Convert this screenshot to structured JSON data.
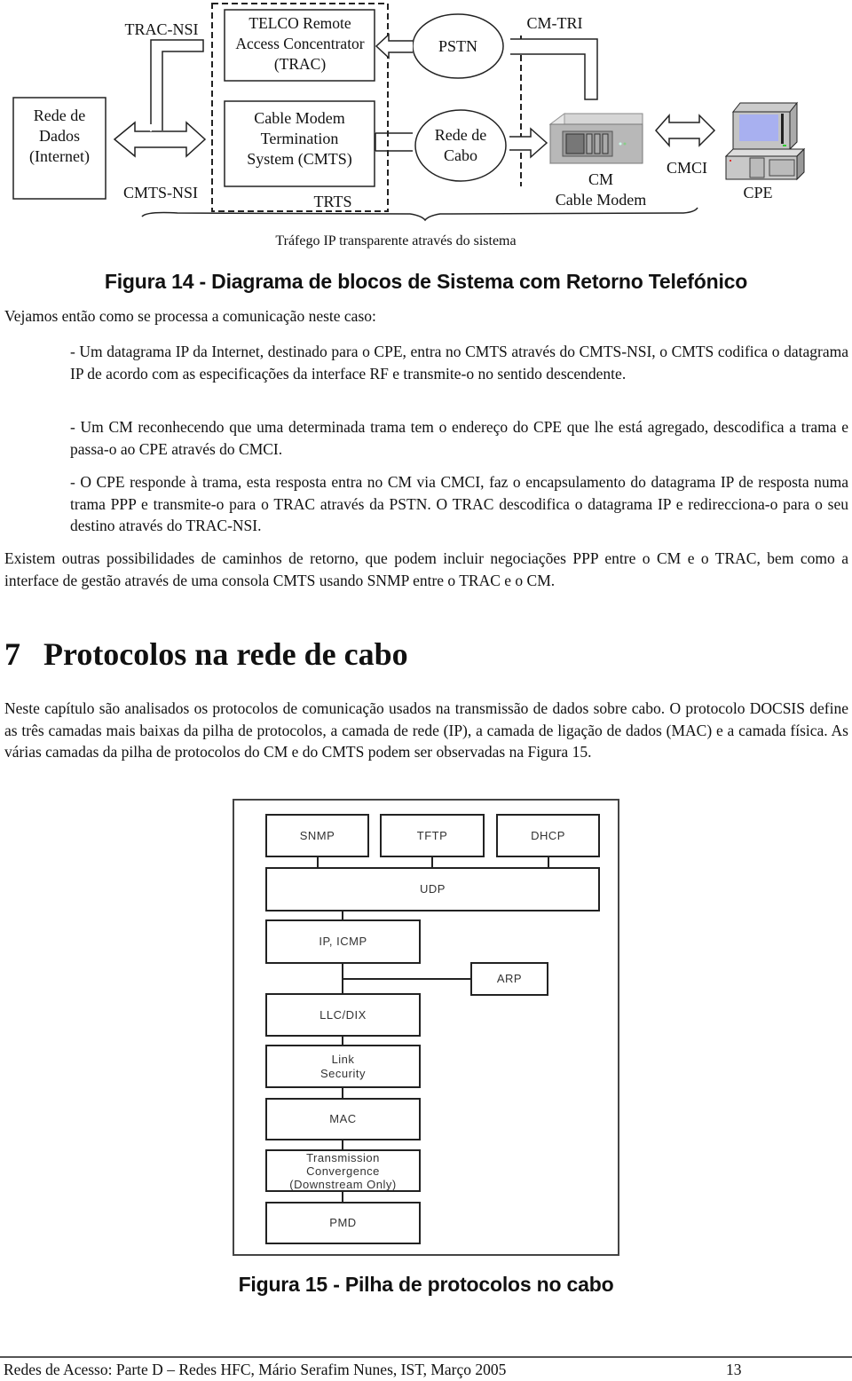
{
  "figure14": {
    "labels": {
      "trac_nsi": "TRAC-NSI",
      "cmts_nsi": "CMTS-NSI",
      "trts": "TRTS",
      "cm_tri": "CM-TRI",
      "cmci": "CMCI",
      "cpe": "CPE"
    },
    "blocks": {
      "rede_dados": "Rede de\nDados\n(Internet)",
      "trac": "TELCO Remote\nAccess Concentrator\n(TRAC)",
      "cmts": "Cable Modem\nTermination\nSystem (CMTS)",
      "pstn": "PSTN",
      "rede_cabo": "Rede de\nCabo",
      "cm": "CM\nCable Modem"
    },
    "brace_label": "Tráfego IP transparente através do sistema",
    "caption": "Figura 14 - Diagrama de blocos de Sistema com Retorno Telefónico"
  },
  "body": {
    "intro": "Vejamos então como se processa a comunicação neste caso:",
    "steps": [
      "- Um datagrama IP da Internet, destinado para o CPE, entra no CMTS através do CMTS-NSI, o CMTS codifica o datagrama IP de acordo com as especificações da interface RF e transmite-o no sentido descendente.",
      "- Um CM reconhecendo que uma determinada trama tem o endereço do CPE que lhe está agregado, descodifica a trama e passa-o ao CPE através do CMCI.",
      "- O CPE responde à trama, esta resposta entra no CM via CMCI, faz o encapsulamento do datagrama IP de resposta numa trama PPP e transmite-o para o TRAC através da PSTN. O TRAC descodifica o datagrama IP e redirecciona-o para o seu destino através do TRAC-NSI."
    ],
    "closing": "Existem outras possibilidades de caminhos de retorno, que podem incluir negociações PPP entre o CM e o TRAC, bem como a interface de gestão através de uma consola CMTS usando SNMP entre o TRAC e o CM."
  },
  "section": {
    "number": "7",
    "title": "Protocolos na rede de cabo",
    "paragraph": "Neste capítulo são analisados os protocolos de comunicação usados na transmissão de dados sobre cabo. O protocolo DOCSIS define as três camadas mais baixas da pilha de protocolos, a camada de rede (IP), a camada de ligação de dados (MAC) e a camada física. As várias camadas da pilha de protocolos do CM e do CMTS podem ser observadas na Figura 15."
  },
  "figure15": {
    "layers": {
      "snmp": "SNMP",
      "tftp": "TFTP",
      "dhcp": "DHCP",
      "udp": "UDP",
      "ip_icmp": "IP, ICMP",
      "arp": "ARP",
      "llc_dix": "LLC/DIX",
      "link_security": "Link\nSecurity",
      "mac": "MAC",
      "tc": "Transmission\nConvergence\n(Downstream Only)",
      "pmd": "PMD"
    },
    "caption": "Figura 15 - Pilha de protocolos no cabo"
  },
  "footer": {
    "text": "Redes de Acesso: Parte D – Redes HFC, Mário Serafim Nunes, IST, Março 2005",
    "page": "13"
  }
}
